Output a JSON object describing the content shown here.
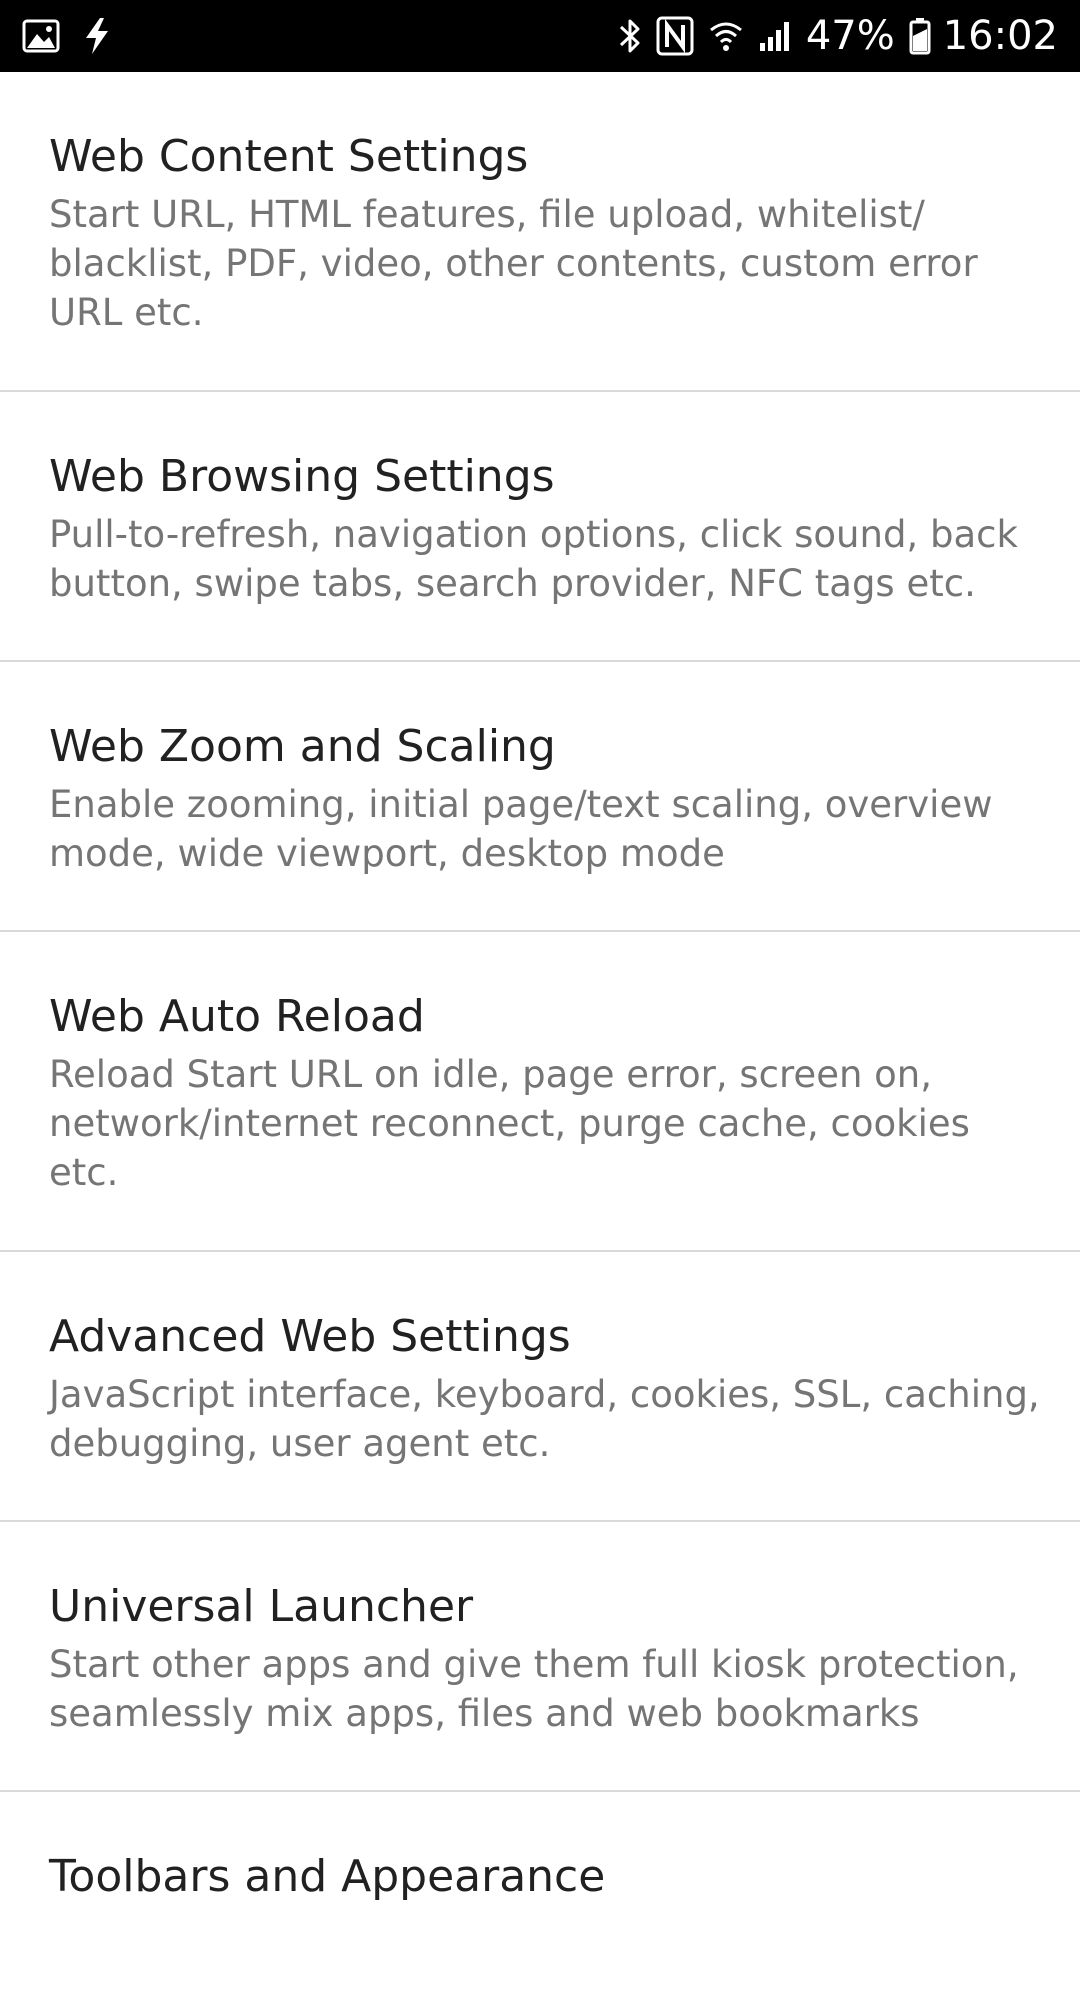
{
  "status_bar": {
    "left_icons": [
      "image-icon",
      "flash-icon"
    ],
    "right_icons": [
      "bluetooth-icon",
      "nfc-icon",
      "wifi-icon",
      "signal-icon",
      "battery-icon"
    ],
    "battery_percent": "47%",
    "time": "16:02"
  },
  "settings": [
    {
      "title": "Web Content Settings",
      "summary": "Start URL, HTML features, file upload, whitelist/ blacklist, PDF, video, other contents, custom error URL etc."
    },
    {
      "title": "Web Browsing Settings",
      "summary": "Pull-to-refresh, navigation options, click sound, back button, swipe tabs, search provider, NFC tags etc."
    },
    {
      "title": "Web Zoom and Scaling",
      "summary": "Enable zooming, initial page/text scaling, overview mode, wide viewport, desktop mode"
    },
    {
      "title": "Web Auto Reload",
      "summary": "Reload Start URL on idle, page error, screen on, network/internet reconnect, purge cache, cookies etc."
    },
    {
      "title": "Advanced Web Settings",
      "summary": "JavaScript interface, keyboard, cookies, SSL, caching, debugging, user agent etc."
    },
    {
      "title": "Universal Launcher",
      "summary": "Start other apps and give them full kiosk protection, seamlessly mix apps, files and web bookmarks"
    },
    {
      "title": "Toolbars and Appearance",
      "summary": ""
    }
  ],
  "colors": {
    "status_bar_bg": "#000000",
    "title_text": "#212121",
    "summary_text": "#757575",
    "divider": "#d9d9d9"
  }
}
